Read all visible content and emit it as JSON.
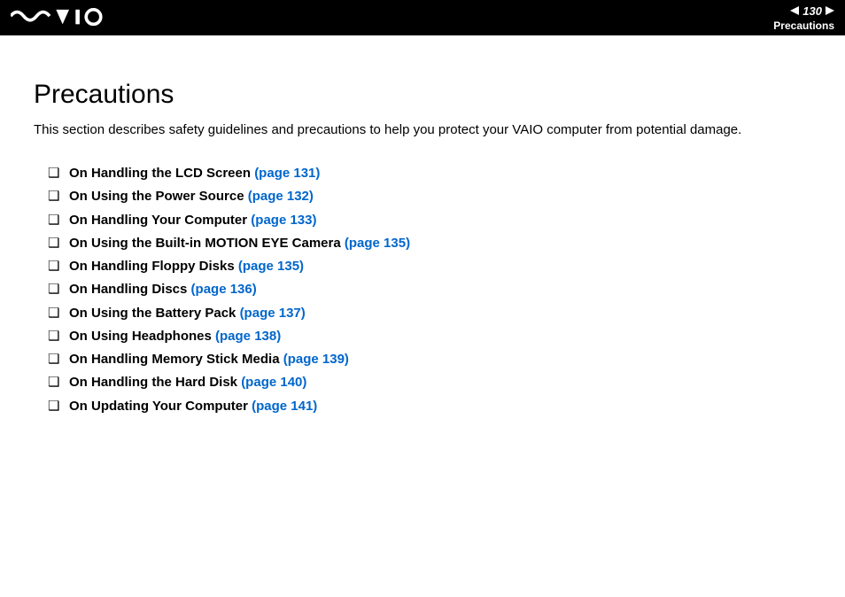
{
  "header": {
    "page_number": "130",
    "breadcrumb": "Precautions"
  },
  "content": {
    "title": "Precautions",
    "intro": "This section describes safety guidelines and precautions to help you protect your VAIO computer from potential damage.",
    "toc": [
      {
        "title": "On Handling the LCD Screen ",
        "page_label": "(page 131)"
      },
      {
        "title": "On Using the Power Source ",
        "page_label": "(page 132)"
      },
      {
        "title": "On Handling Your Computer ",
        "page_label": "(page 133)"
      },
      {
        "title": "On Using the Built-in MOTION EYE Camera ",
        "page_label": "(page 135)"
      },
      {
        "title": "On Handling Floppy Disks ",
        "page_label": "(page 135)"
      },
      {
        "title": "On Handling Discs ",
        "page_label": "(page 136)"
      },
      {
        "title": "On Using the Battery Pack ",
        "page_label": "(page 137)"
      },
      {
        "title": "On Using Headphones ",
        "page_label": "(page 138)"
      },
      {
        "title": "On Handling Memory Stick Media ",
        "page_label": "(page 139)"
      },
      {
        "title": "On Handling the Hard Disk ",
        "page_label": "(page 140)"
      },
      {
        "title": "On Updating Your Computer ",
        "page_label": "(page 141)"
      }
    ]
  }
}
